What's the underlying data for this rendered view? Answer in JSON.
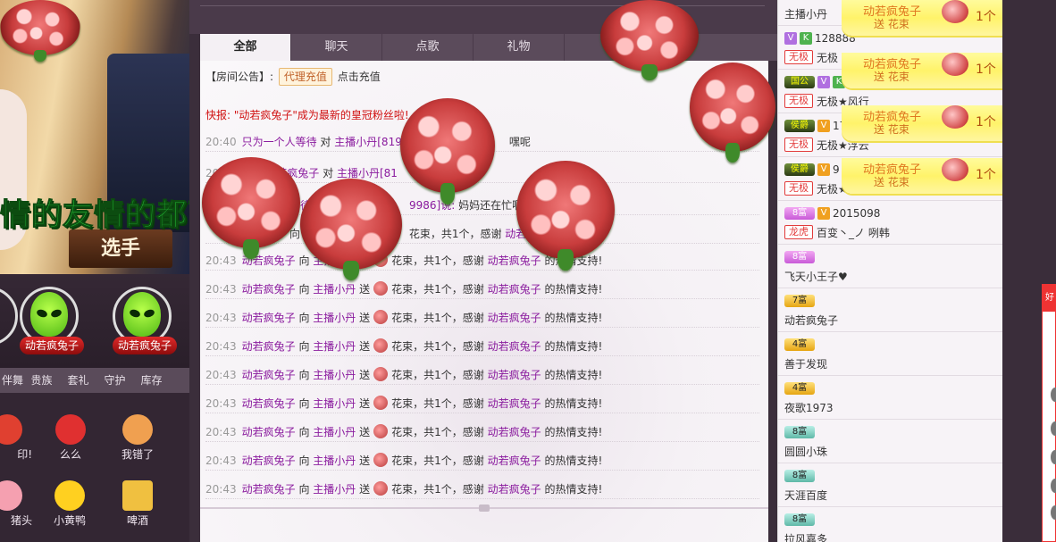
{
  "left": {
    "video_caption": "情的友情的都可以",
    "video_badge": "选手",
    "seats": [
      {
        "name": "动若疯兔子"
      },
      {
        "name": "动若疯兔子"
      }
    ],
    "gift_tabs": [
      "伴舞",
      "贵族",
      "套礼",
      "守护",
      "库存"
    ],
    "gifts": [
      {
        "label": "印!",
        "color": "#e04030"
      },
      {
        "label": "么么",
        "color": "#e03030"
      },
      {
        "label": "我错了",
        "color": "#f0a050"
      },
      {
        "label": "猪头",
        "color": "#f5a0b0"
      },
      {
        "label": "小黄鸭",
        "color": "#ffd020"
      },
      {
        "label": "啤酒",
        "color": "#f0c040"
      }
    ]
  },
  "chat": {
    "tabs": [
      "全部",
      "聊天",
      "点歌",
      "礼物"
    ],
    "active_tab": "全部",
    "car_count": "4",
    "notice": {
      "label": "【房间公告】:",
      "agent_button": "代理充值",
      "link": "点击充值"
    },
    "flash": "快报: \"动若疯兔子\"成为最新的皇冠粉丝啦!",
    "messages": [
      {
        "time": "20:40",
        "parts": [
          "只为一个人等待",
          " 对 ",
          "主播小丹[819",
          "",
          "",
          "嘿呢"
        ]
      },
      {
        "time": "20",
        "parts": [
          "",
          "",
          "动若疯兔子",
          " 对 ",
          "主播小丹[81",
          ""
        ]
      },
      {
        "time": "",
        "parts": [
          "",
          "",
          "等待",
          "",
          "9986]说: ",
          "妈妈还在忙啊"
        ]
      },
      {
        "time": "",
        "parts": [
          "",
          "向 ",
          "",
          "",
          "花束，共1个，感谢 ",
          "动若疯"
        ]
      }
    ],
    "gift_messages": [
      {
        "time": "20:43",
        "user": "动若疯兔子",
        "to": "向",
        "host": "主播小丹",
        "send": "送",
        "text": "花束，共1个，感谢",
        "thanks_user": "动若疯兔子",
        "tail": "的热情支持!"
      },
      {
        "time": "20:43",
        "user": "动若疯兔子",
        "to": "向",
        "host": "主播小丹",
        "send": "送",
        "text": "花束，共1个，感谢",
        "thanks_user": "动若疯兔子",
        "tail": "的热情支持!"
      },
      {
        "time": "20:43",
        "user": "动若疯兔子",
        "to": "向",
        "host": "主播小丹",
        "send": "送",
        "text": "花束，共1个，感谢",
        "thanks_user": "动若疯兔子",
        "tail": "的热情支持!"
      },
      {
        "time": "20:43",
        "user": "动若疯兔子",
        "to": "向",
        "host": "主播小丹",
        "send": "送",
        "text": "花束，共1个，感谢",
        "thanks_user": "动若疯兔子",
        "tail": "的热情支持!"
      },
      {
        "time": "20:43",
        "user": "动若疯兔子",
        "to": "向",
        "host": "主播小丹",
        "send": "送",
        "text": "花束，共1个，感谢",
        "thanks_user": "动若疯兔子",
        "tail": "的热情支持!"
      },
      {
        "time": "20:43",
        "user": "动若疯兔子",
        "to": "向",
        "host": "主播小丹",
        "send": "送",
        "text": "花束，共1个，感谢",
        "thanks_user": "动若疯兔子",
        "tail": "的热情支持!"
      },
      {
        "time": "20:43",
        "user": "动若疯兔子",
        "to": "向",
        "host": "主播小丹",
        "send": "送",
        "text": "花束，共1个，感谢",
        "thanks_user": "动若疯兔子",
        "tail": "的热情支持!"
      },
      {
        "time": "20:43",
        "user": "动若疯兔子",
        "to": "向",
        "host": "主播小丹",
        "send": "送",
        "text": "花束，共1个，感谢",
        "thanks_user": "动若疯兔子",
        "tail": "的热情支持!"
      },
      {
        "time": "20:43",
        "user": "动若疯兔子",
        "to": "向",
        "host": "主播小丹",
        "send": "送",
        "text": "花束，共1个，感谢",
        "thanks_user": "动若疯兔子",
        "tail": "的热情支持!"
      }
    ]
  },
  "users": [
    {
      "id": "",
      "level": "",
      "name": "主播小丹",
      "level_style": "",
      "tag": ""
    },
    {
      "id": "128888",
      "level": "",
      "name": "无极",
      "level_style": "dark",
      "tag": "无极"
    },
    {
      "id": "8692268",
      "level": "国公",
      "name": "无极★风行",
      "level_style": "dark",
      "tag": "无极"
    },
    {
      "id": "17",
      "level": "侯爵",
      "name": "无极★浮云",
      "level_style": "dark",
      "tag": "无极"
    },
    {
      "id": "9",
      "level": "侯爵",
      "name": "无极★闯闯入",
      "level_style": "dark",
      "tag": "无极"
    },
    {
      "id": "2015098",
      "level": "8富",
      "name": "百变丶_ノ 咧韩",
      "level_style": "purple",
      "tag": "龙虎"
    },
    {
      "id": "",
      "level": "8富",
      "name": "飞天小王子♥",
      "level_style": "purple",
      "tag": ""
    },
    {
      "id": "",
      "level": "7富",
      "name": "动若疯兔子",
      "level_style": "gold",
      "tag": ""
    },
    {
      "id": "",
      "level": "4富",
      "name": "善于发现",
      "level_style": "gold",
      "tag": ""
    },
    {
      "id": "",
      "level": "4富",
      "name": "夜歌1973",
      "level_style": "gold",
      "tag": ""
    },
    {
      "id": "",
      "level": "8富",
      "name": "圆圆小珠",
      "level_style": "teal",
      "tag": ""
    },
    {
      "id": "",
      "level": "8富",
      "name": "天涯百度",
      "level_style": "teal",
      "tag": ""
    },
    {
      "id": "",
      "level": "8富",
      "name": "拉风嘉多",
      "level_style": "teal",
      "tag": ""
    }
  ],
  "gift_notes": [
    {
      "who": "动若疯兔子",
      "what": "送 花束",
      "count": "1个"
    },
    {
      "who": "动若疯兔子",
      "what": "送 花束",
      "count": "1个"
    },
    {
      "who": "动若疯兔子",
      "what": "送 花束",
      "count": "1个"
    },
    {
      "who": "动若疯兔子",
      "what": "送 花束",
      "count": "1个"
    }
  ],
  "farright": {
    "label": "好"
  }
}
